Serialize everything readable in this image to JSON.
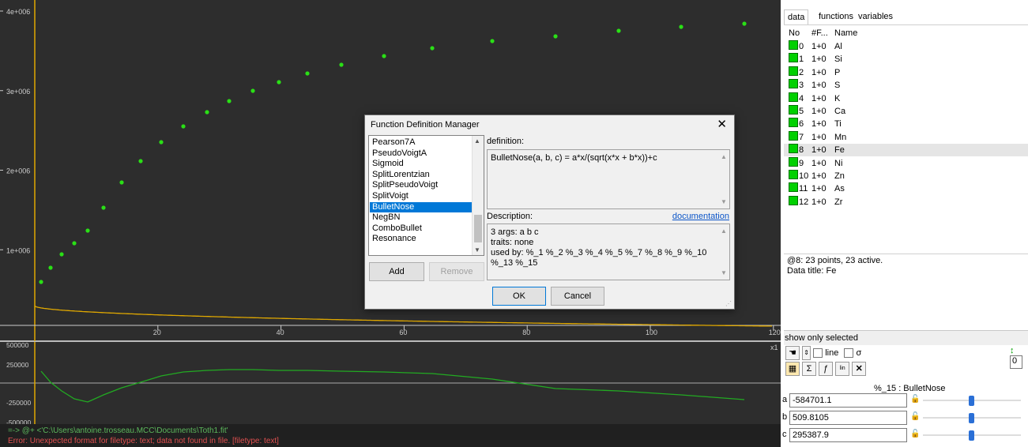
{
  "main_plot": {
    "y_ticks": [
      "4e+006",
      "3e+006",
      "2e+006",
      "1e+006"
    ],
    "x_ticks": [
      "20",
      "40",
      "60",
      "80",
      "100",
      "120"
    ],
    "colors": {
      "background": "#2d2d2d",
      "points": "#2adf16",
      "curve": "#e0a800",
      "zero_axis": "#e0a800",
      "residual": "#22aa22"
    }
  },
  "residual_plot": {
    "y_ticks": [
      "500000",
      "250000",
      "-250000",
      "-500000"
    ],
    "corner_label": "x1"
  },
  "console": {
    "command": "=-> @+ <'C:\\Users\\antoine.trosseau.MCC\\Documents\\Toth1.fit'",
    "error": "Error: Unexpected format for filetype: text; data not found in file. [filetype: text]",
    "command_color": "#5cb85c",
    "error_color": "#e05050"
  },
  "dialog": {
    "title": "Function Definition Manager",
    "close_icon": "✕",
    "functions": [
      "Pearson7A",
      "PseudoVoigtA",
      "Sigmoid",
      "SplitLorentzian",
      "SplitPseudoVoigt",
      "SplitVoigt",
      "BulletNose",
      "NegBN",
      "ComboBullet",
      "Resonance"
    ],
    "selected_function": "BulletNose",
    "definition_label": "definition:",
    "definition_text": "BulletNose(a, b, c) = a*x/(sqrt(x*x + b*x))+c",
    "description_label": "Description:",
    "documentation_link": "documentation",
    "description_lines": [
      "3 args: a b c",
      "traits: none",
      "used by: %_1 %_2 %_3 %_4 %_5 %_7 %_8 %_9 %_10 %_13 %_15"
    ],
    "add_label": "Add",
    "remove_label": "Remove",
    "ok_label": "OK",
    "cancel_label": "Cancel"
  },
  "right_panel": {
    "tabs": [
      "data",
      "functions",
      "variables"
    ],
    "columns": [
      "No",
      "#F...",
      "Name"
    ],
    "rows": [
      {
        "no": "0",
        "f": "1+0",
        "name": "Al"
      },
      {
        "no": "1",
        "f": "1+0",
        "name": "Si"
      },
      {
        "no": "2",
        "f": "1+0",
        "name": "P"
      },
      {
        "no": "3",
        "f": "1+0",
        "name": "S"
      },
      {
        "no": "4",
        "f": "1+0",
        "name": "K"
      },
      {
        "no": "5",
        "f": "1+0",
        "name": "Ca"
      },
      {
        "no": "6",
        "f": "1+0",
        "name": "Ti"
      },
      {
        "no": "7",
        "f": "1+0",
        "name": "Mn"
      },
      {
        "no": "8",
        "f": "1+0",
        "name": "Fe"
      },
      {
        "no": "9",
        "f": "1+0",
        "name": "Ni"
      },
      {
        "no": "10",
        "f": "1+0",
        "name": "Zn"
      },
      {
        "no": "11",
        "f": "1+0",
        "name": "As"
      },
      {
        "no": "12",
        "f": "1+0",
        "name": "Zr"
      }
    ],
    "selected_row": 8,
    "info_line1": "@8: 23 points, 23 active.",
    "info_line2": "Data title: Fe",
    "show_only_selected": "show only selected",
    "line_label": "line",
    "sigma_label": "σ",
    "spin_value": "0",
    "function_label": "%_15 : BulletNose",
    "params": [
      {
        "letter": "a",
        "value": "-584701.1",
        "slider": 0.5
      },
      {
        "letter": "b",
        "value": "509.8105",
        "slider": 0.5
      },
      {
        "letter": "c",
        "value": "295387.9",
        "slider": 0.5
      }
    ]
  }
}
